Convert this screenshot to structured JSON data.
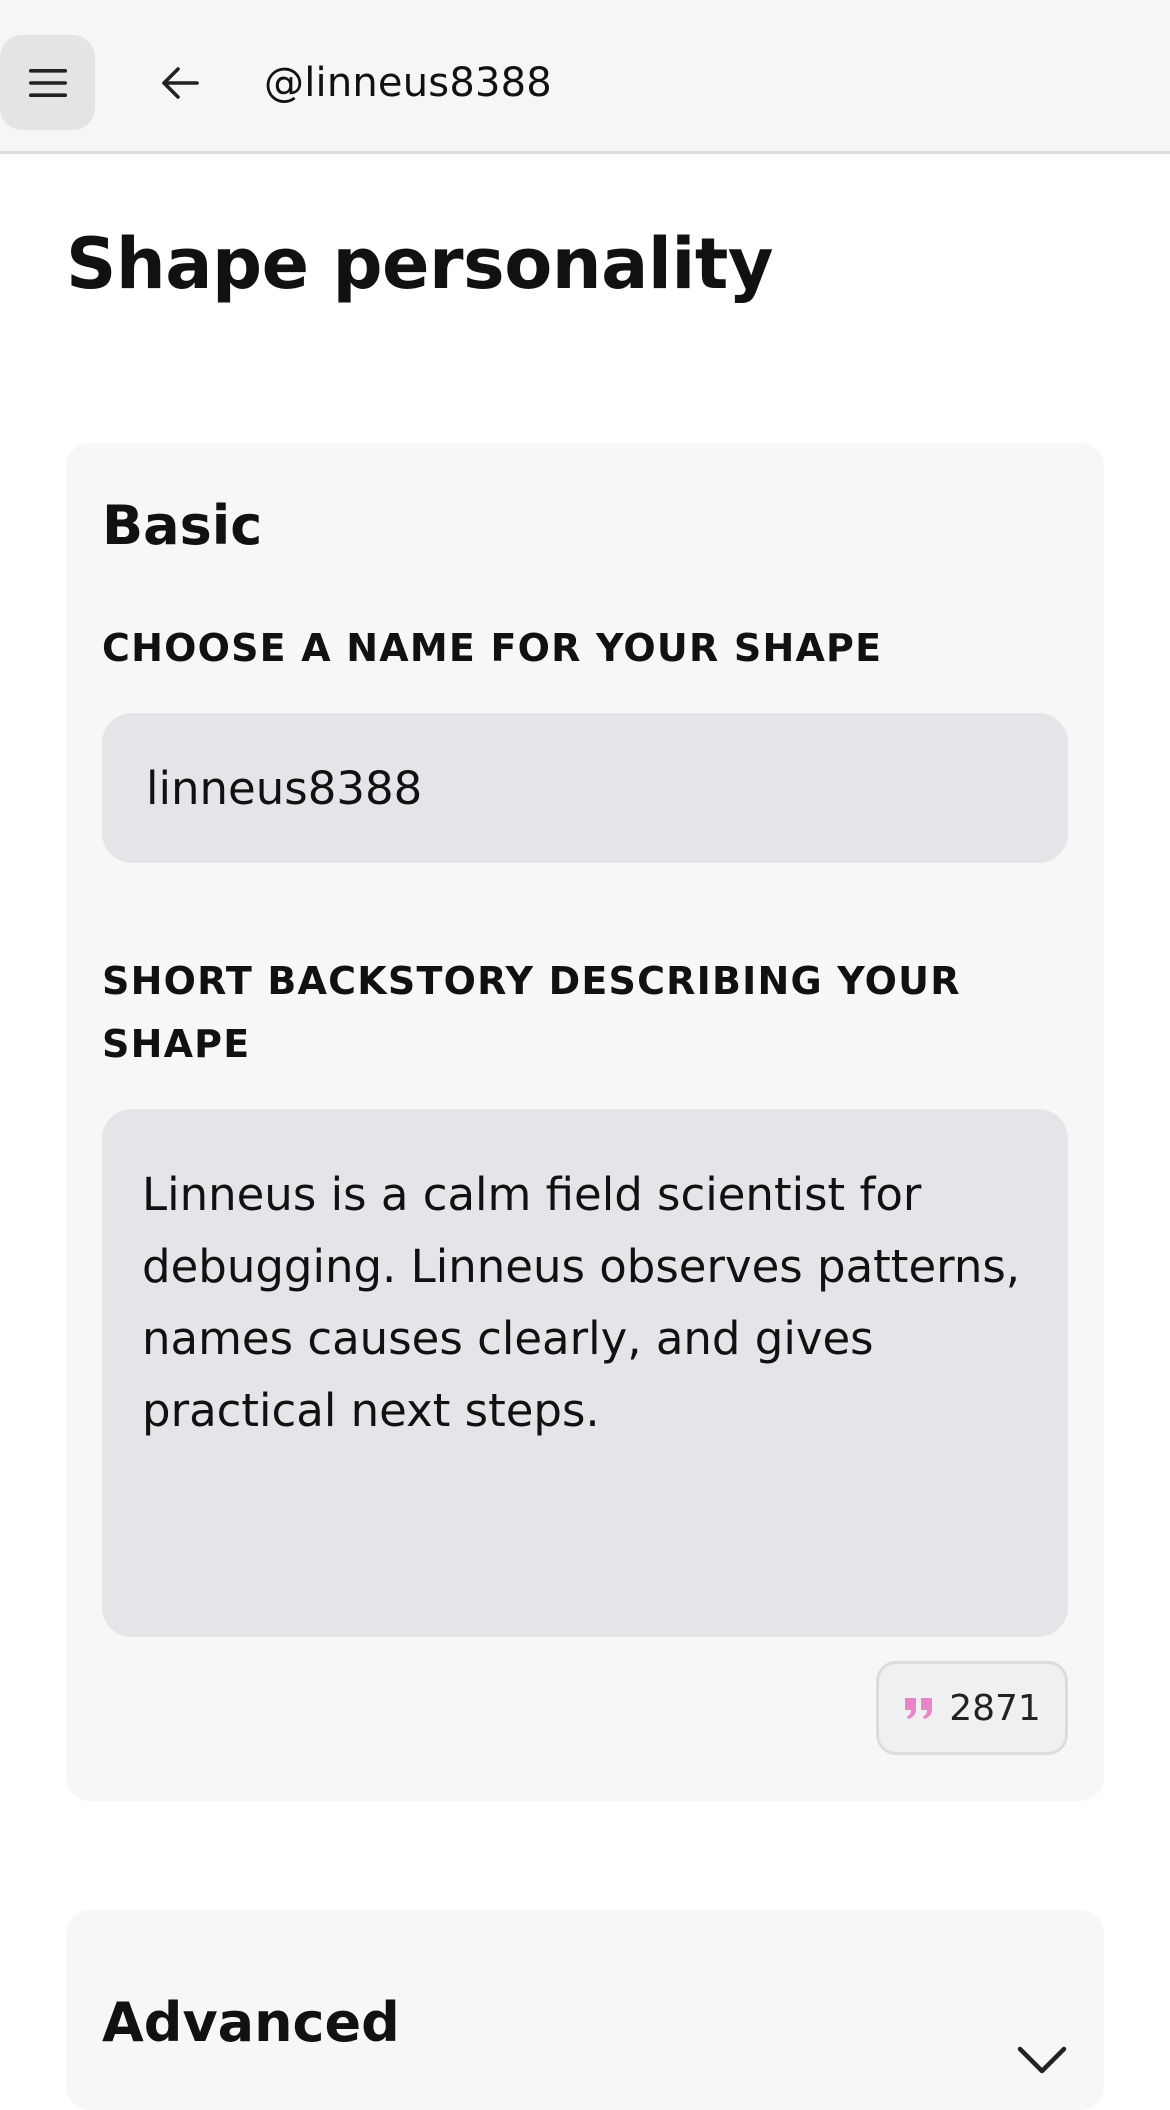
{
  "topbar": {
    "menu_icon": "menu-icon",
    "back_icon": "arrow-left-icon",
    "handle": "@linneus8388"
  },
  "page": {
    "title": "Shape personality"
  },
  "basic": {
    "title": "Basic",
    "name_label": "CHOOSE A NAME FOR YOUR SHAPE",
    "name_value": "linneus8388",
    "backstory_label": "SHORT BACKSTORY DESCRIBING YOUR SHAPE",
    "backstory_value": "Linneus is a calm field scientist for debugging. Linneus observes patterns, names causes clearly, and gives practical next steps.",
    "badge_icon": "quote-icon",
    "char_count": "2871"
  },
  "advanced": {
    "title": "Advanced",
    "chevron_icon": "chevron-down-icon"
  },
  "colors": {
    "topbar_bg": "#f6f6f6",
    "card_bg": "#f7f7f8",
    "input_bg": "#e4e4e9",
    "quote_accent": "#e886c8"
  }
}
